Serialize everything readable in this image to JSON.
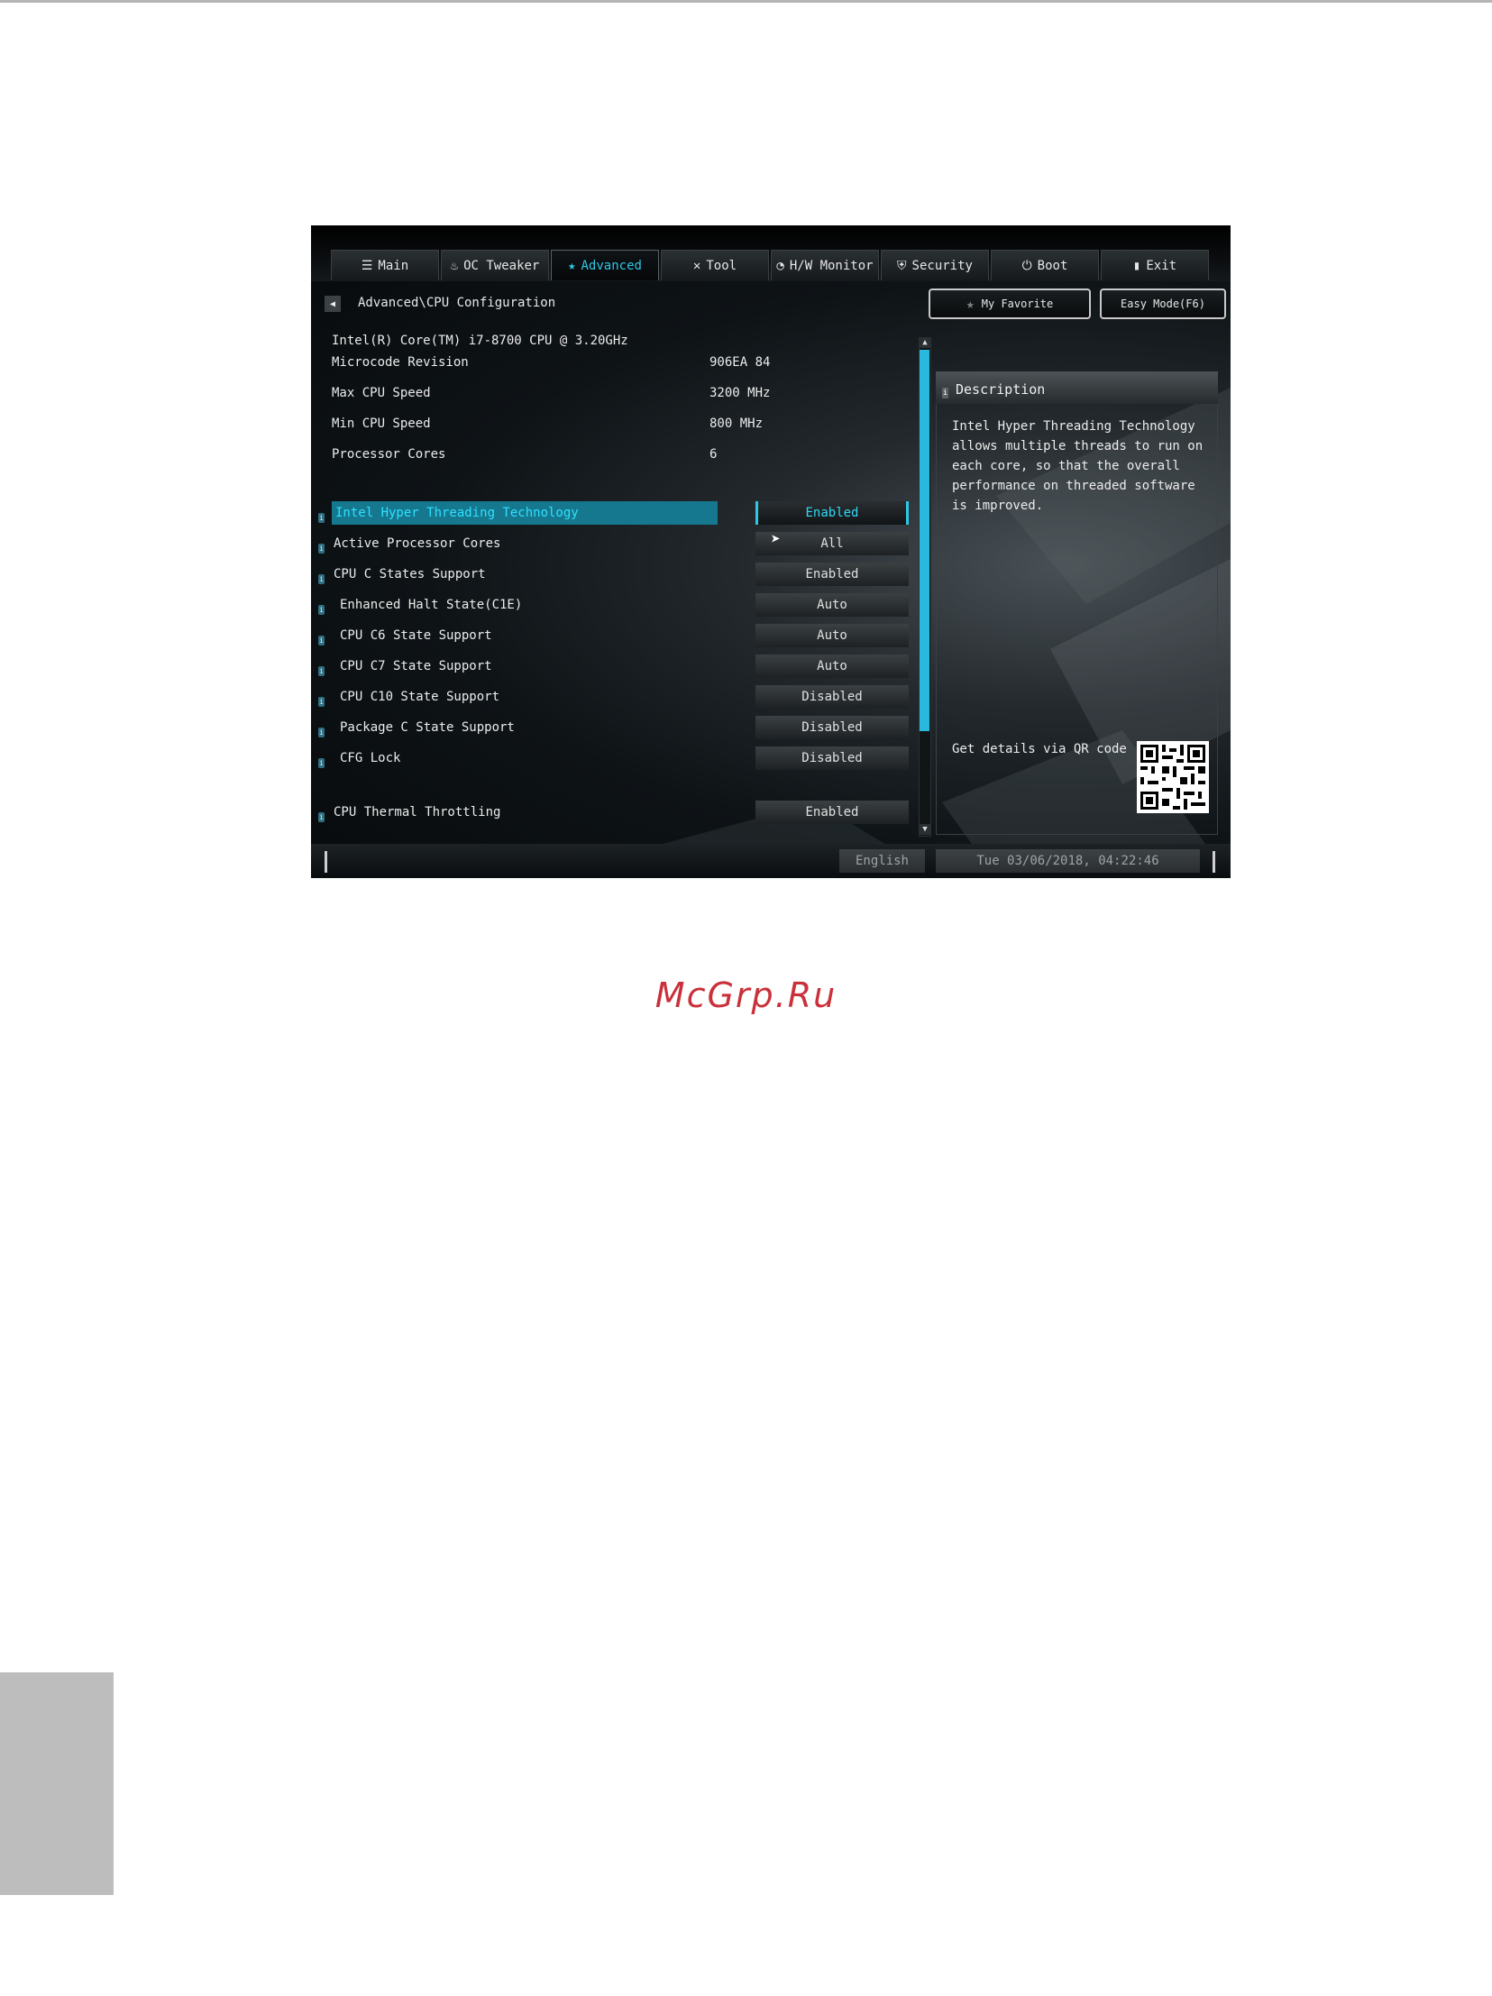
{
  "watermark": "McGrp.Ru",
  "tabs": [
    {
      "icon": "☰",
      "label": "Main",
      "active": false
    },
    {
      "icon": "♨",
      "label": "OC Tweaker",
      "active": false
    },
    {
      "icon": "★",
      "label": "Advanced",
      "active": true
    },
    {
      "icon": "✕",
      "label": "Tool",
      "active": false
    },
    {
      "icon": "◔",
      "label": "H/W Monitor",
      "active": false
    },
    {
      "icon": "⛨",
      "label": "Security",
      "active": false
    },
    {
      "icon": "⏻",
      "label": "Boot",
      "active": false
    },
    {
      "icon": "▮",
      "label": "Exit",
      "active": false
    }
  ],
  "breadcrumb": "Advanced\\CPU Configuration",
  "my_favorite": "My Favorite",
  "easy_mode": "Easy Mode(F6)",
  "cpu_info": {
    "model": "Intel(R) Core(TM) i7-8700 CPU @ 3.20GHz",
    "rows": [
      {
        "label": "Microcode Revision",
        "value": "906EA 84"
      },
      {
        "label": "Max CPU Speed",
        "value": "3200 MHz"
      },
      {
        "label": "Min CPU Speed",
        "value": "800 MHz"
      },
      {
        "label": "Processor Cores",
        "value": "6"
      }
    ]
  },
  "options": [
    {
      "label": "Intel Hyper Threading Technology",
      "value": "Enabled"
    },
    {
      "label": "Active Processor Cores",
      "value": "All"
    },
    {
      "label": "CPU C States Support",
      "value": "Enabled"
    },
    {
      "label": "Enhanced Halt State(C1E)",
      "value": "Auto"
    },
    {
      "label": "CPU C6 State Support",
      "value": "Auto"
    },
    {
      "label": "CPU C7 State Support",
      "value": "Auto"
    },
    {
      "label": "CPU C10 State Support",
      "value": "Disabled"
    },
    {
      "label": "Package C State Support",
      "value": "Disabled"
    },
    {
      "label": "CFG Lock",
      "value": "Disabled"
    },
    {
      "label": "CPU Thermal Throttling",
      "value": "Enabled"
    }
  ],
  "description": {
    "title": "Description",
    "text": "Intel Hyper Threading Technology allows multiple threads to run on each core, so that the overall performance on threaded software is improved.",
    "qr_label": "Get details via QR code"
  },
  "status": {
    "language": "English",
    "datetime": "Tue 03/06/2018, 04:22:46"
  }
}
